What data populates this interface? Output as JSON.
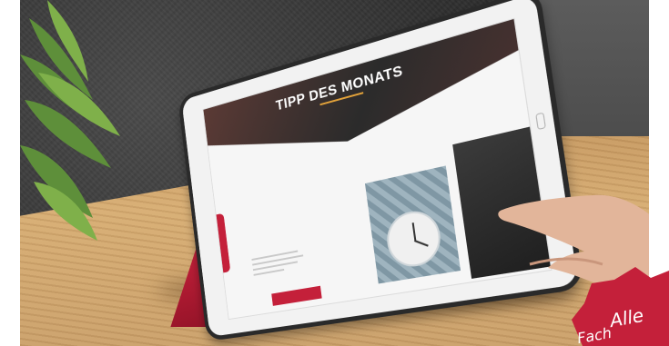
{
  "screen": {
    "hero_title": "TIPP DES MONATS"
  },
  "badge": {
    "line1": "Alle",
    "line2": "Fach"
  },
  "colors": {
    "brand_red": "#c4203a",
    "accent_gold": "#e2a23a",
    "desk_wood": "#d7ad73"
  }
}
